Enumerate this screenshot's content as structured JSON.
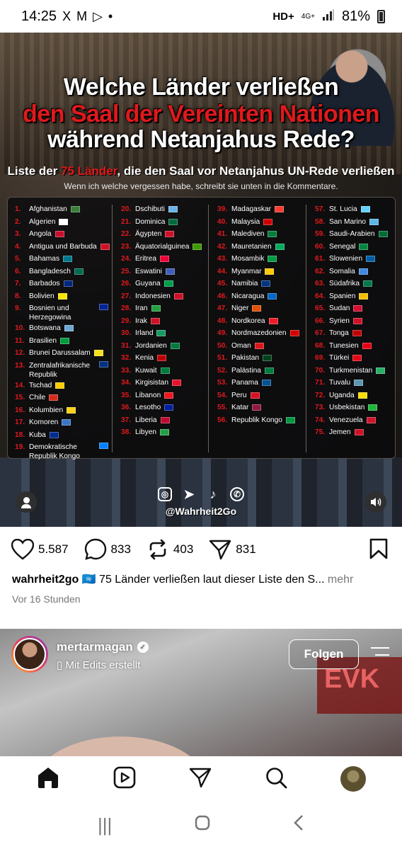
{
  "status_bar": {
    "time": "14:25",
    "left_icons": [
      "X",
      "M",
      "▷",
      "•"
    ],
    "right_text": "HD+",
    "network": "4G+",
    "battery": "81%"
  },
  "post_image": {
    "headline_line1": "Welche Länder verließen",
    "headline_line2": "den Saal der Vereinten Nationen",
    "headline_line3": "während Netanjahus Rede?",
    "list_title_pre": "Liste der ",
    "list_title_count": "75 Länder",
    "list_title_post": ", die den Saal vor Netanjahus UN-Rede verließen",
    "list_subtitle": "Wenn ich welche vergessen habe, schreibt sie unten in die Kommentare.",
    "handle": "@Wahrheit2Go",
    "columns": [
      [
        {
          "num": "1.",
          "name": "Afghanistan",
          "flag": "#3a7d3a"
        },
        {
          "num": "2.",
          "name": "Algerien",
          "flag": "#ffffff"
        },
        {
          "num": "3.",
          "name": "Angola",
          "flag": "#c8102e"
        },
        {
          "num": "4.",
          "name": "Antigua und Barbuda",
          "flag": "#ce1126"
        },
        {
          "num": "5.",
          "name": "Bahamas",
          "flag": "#00778b"
        },
        {
          "num": "6.",
          "name": "Bangladesch",
          "flag": "#006a4e"
        },
        {
          "num": "7.",
          "name": "Barbados",
          "flag": "#00267f"
        },
        {
          "num": "8.",
          "name": "Bolivien",
          "flag": "#f9e300"
        },
        {
          "num": "9.",
          "name": "Bosnien und Herzegowina",
          "flag": "#002395",
          "two": true
        },
        {
          "num": "10.",
          "name": "Botswana",
          "flag": "#6da9d2"
        },
        {
          "num": "11.",
          "name": "Brasilien",
          "flag": "#009c3b"
        },
        {
          "num": "12.",
          "name": "Brunei Darussalam",
          "flag": "#f7e017"
        },
        {
          "num": "13.",
          "name": "Zentralafrikanische Republik",
          "flag": "#003082",
          "two": true
        },
        {
          "num": "14.",
          "name": "Tschad",
          "flag": "#fecb00"
        },
        {
          "num": "15.",
          "name": "Chile",
          "flag": "#d52b1e"
        },
        {
          "num": "16.",
          "name": "Kolumbien",
          "flag": "#fcd116"
        },
        {
          "num": "17.",
          "name": "Komoren",
          "flag": "#3a75c4"
        },
        {
          "num": "18.",
          "name": "Kuba",
          "flag": "#002a8f"
        },
        {
          "num": "19.",
          "name": "Demokratische Republik Kongo",
          "flag": "#007fff",
          "two": true
        }
      ],
      [
        {
          "num": "20.",
          "name": "Dschibuti",
          "flag": "#6ab2e7"
        },
        {
          "num": "21.",
          "name": "Dominica",
          "flag": "#006b3f"
        },
        {
          "num": "22.",
          "name": "Ägypten",
          "flag": "#ce1126"
        },
        {
          "num": "23.",
          "name": "Äquatorialguinea",
          "flag": "#3e9a00"
        },
        {
          "num": "24.",
          "name": "Eritrea",
          "flag": "#ea0437"
        },
        {
          "num": "25.",
          "name": "Eswatini",
          "flag": "#3e5eb9"
        },
        {
          "num": "26.",
          "name": "Guyana",
          "flag": "#009e49"
        },
        {
          "num": "27.",
          "name": "Indonesien",
          "flag": "#ce1126"
        },
        {
          "num": "28.",
          "name": "Iran",
          "flag": "#239f40"
        },
        {
          "num": "29.",
          "name": "Irak",
          "flag": "#ce1126"
        },
        {
          "num": "30.",
          "name": "Irland",
          "flag": "#169b62"
        },
        {
          "num": "31.",
          "name": "Jordanien",
          "flag": "#007a3d"
        },
        {
          "num": "32.",
          "name": "Kenia",
          "flag": "#bb0000"
        },
        {
          "num": "33.",
          "name": "Kuwait",
          "flag": "#007a3d"
        },
        {
          "num": "34.",
          "name": "Kirgisistan",
          "flag": "#e8112d"
        },
        {
          "num": "35.",
          "name": "Libanon",
          "flag": "#ee161f"
        },
        {
          "num": "36.",
          "name": "Lesotho",
          "flag": "#00209f"
        },
        {
          "num": "37.",
          "name": "Liberia",
          "flag": "#bf0a30"
        },
        {
          "num": "38.",
          "name": "Libyen",
          "flag": "#239e46"
        }
      ],
      [
        {
          "num": "39.",
          "name": "Madagaskar",
          "flag": "#fc3d32"
        },
        {
          "num": "40.",
          "name": "Malaysia",
          "flag": "#cc0001"
        },
        {
          "num": "41.",
          "name": "Malediven",
          "flag": "#007e3a"
        },
        {
          "num": "42.",
          "name": "Mauretanien",
          "flag": "#00a95c"
        },
        {
          "num": "43.",
          "name": "Mosambik",
          "flag": "#009a44"
        },
        {
          "num": "44.",
          "name": "Myanmar",
          "flag": "#fecb00"
        },
        {
          "num": "45.",
          "name": "Namibia",
          "flag": "#003580"
        },
        {
          "num": "46.",
          "name": "Nicaragua",
          "flag": "#0067c6"
        },
        {
          "num": "47.",
          "name": "Niger",
          "flag": "#e05206"
        },
        {
          "num": "48.",
          "name": "Nordkorea",
          "flag": "#ed1c27"
        },
        {
          "num": "49.",
          "name": "Nordmazedonien",
          "flag": "#d20000"
        },
        {
          "num": "50.",
          "name": "Oman",
          "flag": "#db161b"
        },
        {
          "num": "51.",
          "name": "Pakistan",
          "flag": "#01411c"
        },
        {
          "num": "52.",
          "name": "Palästina",
          "flag": "#007a3d"
        },
        {
          "num": "53.",
          "name": "Panama",
          "flag": "#005293"
        },
        {
          "num": "54.",
          "name": "Peru",
          "flag": "#d91023"
        },
        {
          "num": "55.",
          "name": "Katar",
          "flag": "#8d1b3d"
        },
        {
          "num": "56.",
          "name": "Republik Kongo",
          "flag": "#009543"
        }
      ],
      [
        {
          "num": "57.",
          "name": "St. Lucia",
          "flag": "#65cfff"
        },
        {
          "num": "58.",
          "name": "San Marino",
          "flag": "#5eb6e4"
        },
        {
          "num": "59.",
          "name": "Saudi-Arabien",
          "flag": "#006c35"
        },
        {
          "num": "60.",
          "name": "Senegal",
          "flag": "#00853f"
        },
        {
          "num": "61.",
          "name": "Slowenien",
          "flag": "#005da4"
        },
        {
          "num": "62.",
          "name": "Somalia",
          "flag": "#4189dd"
        },
        {
          "num": "63.",
          "name": "Südafrika",
          "flag": "#007749"
        },
        {
          "num": "64.",
          "name": "Spanien",
          "flag": "#f1bf00"
        },
        {
          "num": "65.",
          "name": "Sudan",
          "flag": "#d21034"
        },
        {
          "num": "66.",
          "name": "Syrien",
          "flag": "#ce1126"
        },
        {
          "num": "67.",
          "name": "Tonga",
          "flag": "#c10000"
        },
        {
          "num": "68.",
          "name": "Tunesien",
          "flag": "#e70013"
        },
        {
          "num": "69.",
          "name": "Türkei",
          "flag": "#e30a17"
        },
        {
          "num": "70.",
          "name": "Turkmenistan",
          "flag": "#28ae66"
        },
        {
          "num": "71.",
          "name": "Tuvalu",
          "flag": "#5b97b1"
        },
        {
          "num": "72.",
          "name": "Uganda",
          "flag": "#fcdc04"
        },
        {
          "num": "73.",
          "name": "Usbekistan",
          "flag": "#1eb53a"
        },
        {
          "num": "74.",
          "name": "Venezuela",
          "flag": "#cf142b"
        },
        {
          "num": "75.",
          "name": "Jemen",
          "flag": "#ce1126"
        }
      ]
    ]
  },
  "actions": {
    "likes": "5.587",
    "comments": "833",
    "reposts": "403",
    "shares": "831"
  },
  "caption": {
    "username": "wahrheit2go",
    "flag_emoji": "🇺🇳",
    "text": " 75 Länder verließen laut dieser Liste den S... ",
    "more": "mehr",
    "time": "Vor 16 Stunden"
  },
  "next_post": {
    "username": "mertarmagan",
    "edit_label": "Mit Edits erstellt",
    "follow_label": "Folgen",
    "sign_text": "EVK"
  },
  "colors": {
    "accent_red": "#e0191c",
    "text_muted": "#777777"
  }
}
